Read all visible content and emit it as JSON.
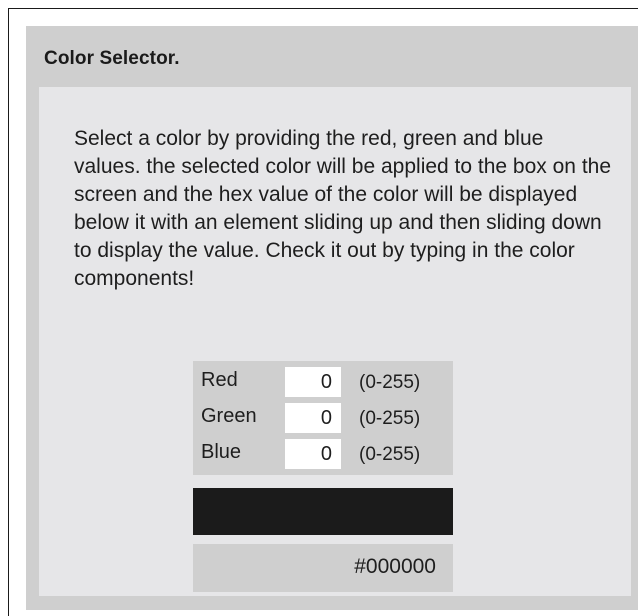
{
  "panel": {
    "title": "Color Selector.",
    "description": "Select a color by providing the red, green and blue values. the selected color will be applied to the box on the screen and the hex value of the color will be displayed below it with an element sliding up and then sliding down to display the value. Check it out by typing in the color components!"
  },
  "form": {
    "rows": [
      {
        "label": "Red",
        "value": "0",
        "range": "(0-255)"
      },
      {
        "label": "Green",
        "value": "0",
        "range": "(0-255)"
      },
      {
        "label": "Blue",
        "value": "0",
        "range": "(0-255)"
      }
    ]
  },
  "result": {
    "swatch_color": "#000000",
    "hex_value": "#000000"
  }
}
